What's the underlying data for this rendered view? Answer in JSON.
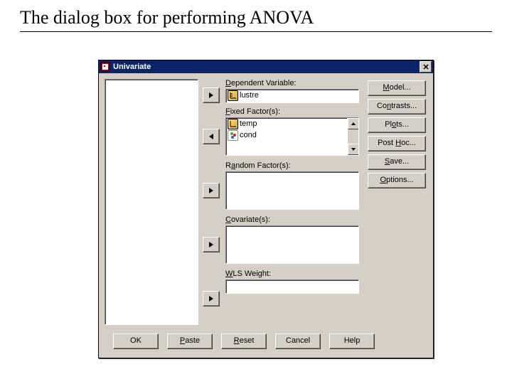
{
  "slide": {
    "title": "The dialog box for performing ANOVA"
  },
  "titlebar": {
    "title": "Univariate",
    "close": "X"
  },
  "labels": {
    "dependent": "Dependent Variable:",
    "fixed": "Fixed Factor(s):",
    "random": "Random Factor(s):",
    "covariate": "Covariate(s):",
    "wls": "WLS Weight:"
  },
  "dep_value": "lustre",
  "fixed_items": [
    "temp",
    "cond"
  ],
  "side_buttons": {
    "model": "Model...",
    "contrasts": "Contrasts...",
    "plots": "Plots...",
    "posthoc": "Post Hoc...",
    "save": "Save...",
    "options": "Options..."
  },
  "bottom_buttons": {
    "ok": "OK",
    "paste": "Paste",
    "reset": "Reset",
    "cancel": "Cancel",
    "help": "Help"
  }
}
